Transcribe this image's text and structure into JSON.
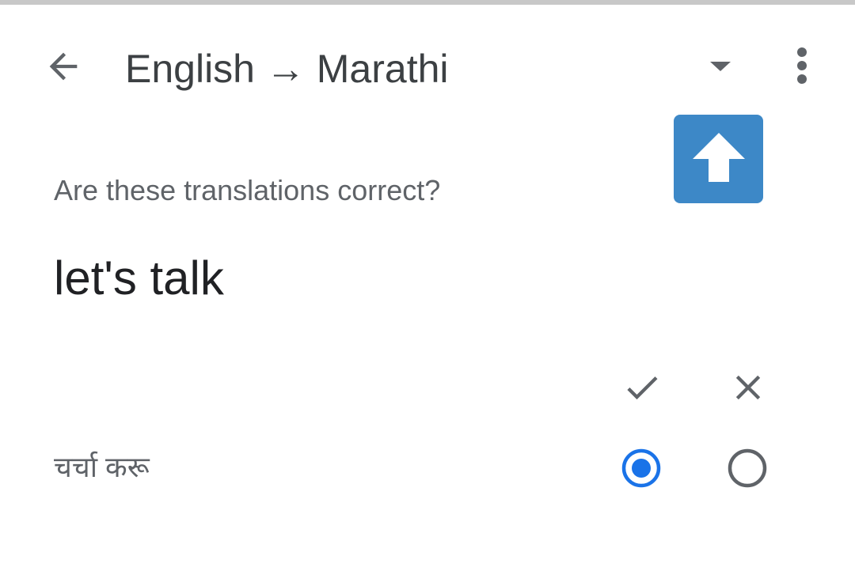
{
  "header": {
    "title": "English → Marathi",
    "back_icon": "arrow-back-icon",
    "dropdown_icon": "arrow-drop-down-icon",
    "menu_icon": "more-vert-icon"
  },
  "upload_button": {
    "icon": "arrow-up-icon",
    "color": "#3d88c7"
  },
  "feedback": {
    "question": "Are these translations correct?",
    "source_phrase": "let's talk",
    "columns": {
      "correct_icon": "check-icon",
      "incorrect_icon": "close-icon"
    },
    "rows": [
      {
        "translation": "चर्चा करू",
        "selected": "correct"
      }
    ],
    "accent_color": "#1a73e8",
    "icon_color": "#5f6368"
  }
}
